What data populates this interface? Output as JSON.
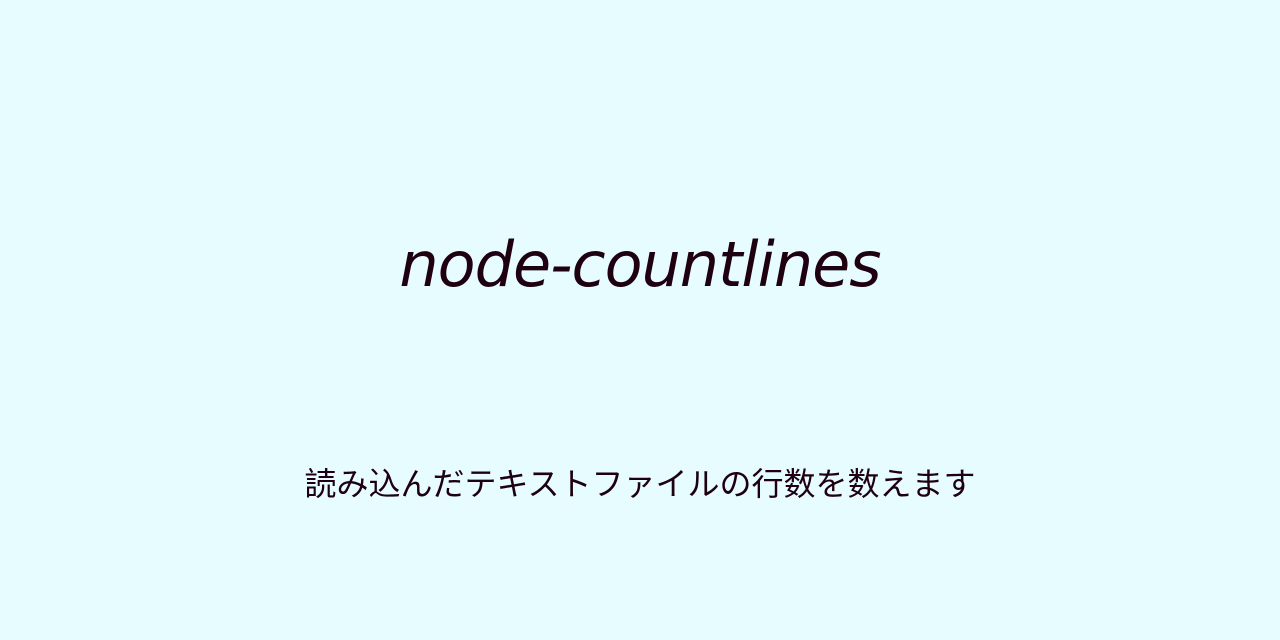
{
  "title": "node-countlines",
  "description": "読み込んだテキストファイルの行数を数えます",
  "colors": {
    "background": "#e6fcff",
    "text": "#1e0010"
  }
}
